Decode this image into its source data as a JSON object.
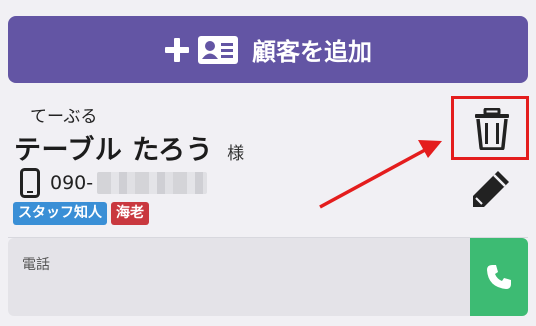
{
  "add_button": {
    "label": "顧客を追加",
    "icon_plus": "plus-icon",
    "icon_card": "contact-card-icon",
    "color": "#6355a4"
  },
  "customer": {
    "kana": "てーぶる",
    "name": "テーブル たろう",
    "honorific": "様",
    "phone_prefix": "090-",
    "phone_icon": "mobile-phone-icon",
    "tags": [
      {
        "label": "スタッフ知人",
        "color": "#3a8fd6"
      },
      {
        "label": "海老",
        "color": "#c9383f"
      }
    ]
  },
  "actions": {
    "delete_icon": "trash-icon",
    "edit_icon": "pencil-icon",
    "highlight_color": "#e41d1d"
  },
  "phone_field": {
    "label": "電話",
    "call_icon": "phone-call-icon",
    "call_color": "#3dbb73"
  }
}
